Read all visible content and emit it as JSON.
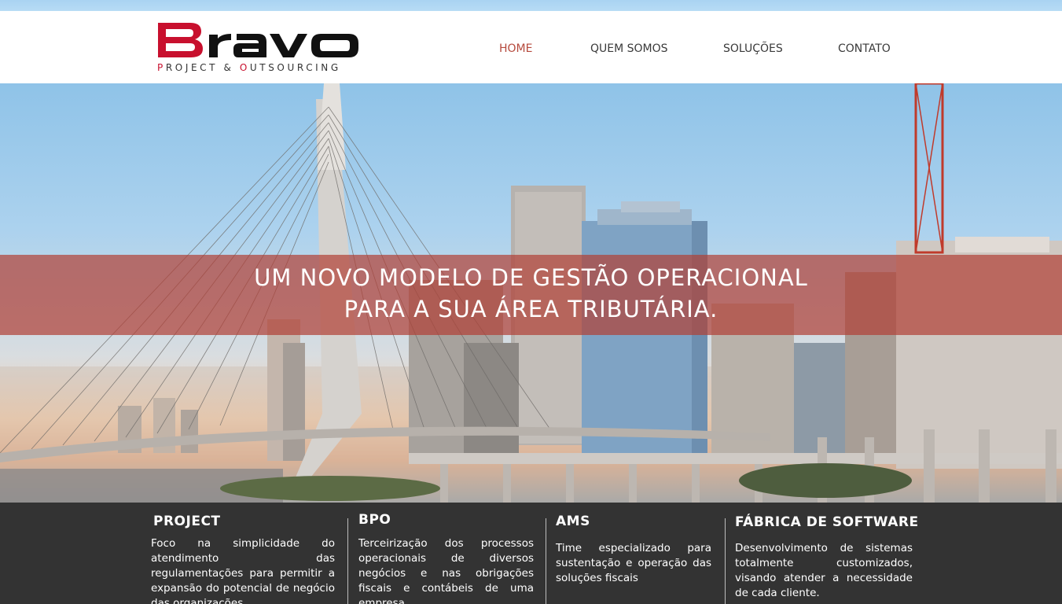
{
  "header": {
    "logo": {
      "brand": "Bravo",
      "tagline_parts": [
        "P",
        "ROJECT & ",
        "O",
        "UTSOURCING"
      ]
    },
    "nav": [
      {
        "label": "HOME",
        "active": true
      },
      {
        "label": "QUEM SOMOS",
        "active": false
      },
      {
        "label": "SOLUÇÕES",
        "active": false
      },
      {
        "label": "CONTATO",
        "active": false
      }
    ]
  },
  "hero": {
    "headline_line1": "UM NOVO MODELO DE GESTÃO OPERACIONAL",
    "headline_line2": "PARA A SUA ÁREA TRIBUTÁRIA."
  },
  "services": [
    {
      "title": "PROJECT",
      "text": "Foco na simplicidade do atendimento das regulamentações para permitir a expansão do potencial de negócio das organizações."
    },
    {
      "title": "BPO",
      "text": "Terceirização dos processos operacionais de diversos negócios e nas obrigações fiscais e contábeis de uma empresa."
    },
    {
      "title": "AMS",
      "text": "Time especializado para sustentação e operação das soluções fiscais"
    },
    {
      "title": "FÁBRICA DE SOFTWARE",
      "text": "Desenvolvimento de sistemas totalmente customizados, visando atender a necessidade de cada cliente."
    }
  ],
  "colors": {
    "brand_red": "#c8102e",
    "nav_active": "#b5493c",
    "banner_overlay": "#b03e34",
    "footer_bg": "#333333"
  }
}
